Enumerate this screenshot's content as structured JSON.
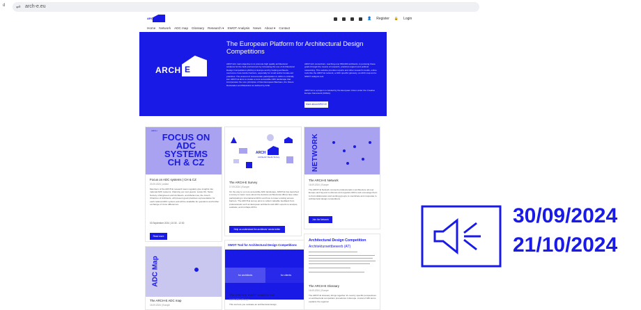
{
  "browser": {
    "left_text": "d",
    "url": "arch-e.eu"
  },
  "header": {
    "logo_text": "ARCH",
    "register_label": "Register",
    "login_label": "Login"
  },
  "nav": [
    "Home",
    "Network",
    "ADC map",
    "Glossary",
    "Research ▾",
    "SWOT Analysis",
    "News",
    "About ▾",
    "Contact"
  ],
  "hero": {
    "logo_arch": "ARCH",
    "logo_e": "E",
    "title": "The European Platform for Architectural Design Competitions",
    "col1": "ARCH-E's main objective is to promote high quality architectural solutions for the built environment by increasing the use of Architectural Design Competitions (ADCs) in Europe and by helping architects overcome cross-border barriers, especially for small and/or female-led practices. The amount of cross-border participation in ADCs is critically low. ARCH-E aims to create a more accessible ADC landscape that incorporates the core principles of New European Bauhaus, the Davos Declaration and Baukultur as defined by ACE.",
    "col2": "ARCH-E's consortium, reaching over 860,000 architects, is pursuing these goals through the means of research, practical support and political networking. This website provides reports and other research results, online tools like the ARCH-E network, a ADC specific glossary, an ADC map and a SWOT analysis tool.",
    "col2b": "ARCH-E is a project co-funded by the European Union under the Creative Europe framework (CREA).",
    "button": "More about ARCH-E"
  },
  "cards": [
    {
      "image_small": "ARCH",
      "image_text": "FOCUS ON ADC SYSTEMS CH & CZ",
      "title": "Focus on ADC systems | CH & CZ",
      "meta": "20.09.2024 | online",
      "text": "Members of the ARCH-E research team regularly give insights into national ADC systems. Claiming our next guests: Lukas Ott, Swiss Society of Engineers and Architects, and Marta Liva, the Czech Chamber of Architects, will present good practices representative for each national ADC system and will be available for questions and further exchange of cross differences.",
      "date": "03 September 2024 | 10:30 - 12:30",
      "button": "Read more"
    },
    {
      "logo_text": "ARCH",
      "logo_sub": "Architects' Needs Survey",
      "title": "The ARCH-E Survey",
      "meta": "17.09.2024 | Europe",
      "text": "On the way to a more accessible ADC landscape, ARCH-E has launched a survey to learn more about the decisive architectural offices face when participating in international ADCs and how to lower existing access barriers. The ARCH-E survey aims to collect valuable feedback from professionals such as European architects and ADC experts to analyse, evaluate, and reshape ADCs.",
      "button": "Help us understand the architects' needs better"
    },
    {
      "image_text": "NETWORK",
      "title": "The ARCH-E Network",
      "meta": "16.09.2024 | Europe",
      "text": "The ARCH-E Network connects professionals in architecture all over Europe and beyond to discuss and organize ADCs and encourage them to find collaborators and working groups to coordinate and cooperate in architectural design competitions.",
      "button": "Join the Network"
    },
    {
      "image_text": "ADC Map",
      "title": "The ARCH-E ADC map",
      "meta": "15.09.2024 | Europe"
    },
    {
      "header": "SWOT Tool for Architectural Design Competitions",
      "left": "for architects",
      "right": "for clients",
      "title": "The ARCH-E SWOT analysis tool",
      "meta": "16.09.2024 | Europe",
      "text": "This tool lets you evaluate an architectural design"
    },
    {
      "header": "Architectural Design Competition",
      "sub": "Architekturwettbewerb (AT)",
      "title": "The ARCH-E Glossary",
      "meta": "16.09.2024 | Europe",
      "text": "The ARCH-E Glossary brings together 11 country specific perspectives on architectural competition procedures in Europe. A total of 180 terms explains the regional"
    }
  ],
  "announcement": {
    "icon": "speaker-icon",
    "date1": "30/09/2024",
    "date2": "21/10/2024"
  },
  "colors": {
    "brand": "#1a1ae6",
    "lavender": "#a8a2f0"
  }
}
